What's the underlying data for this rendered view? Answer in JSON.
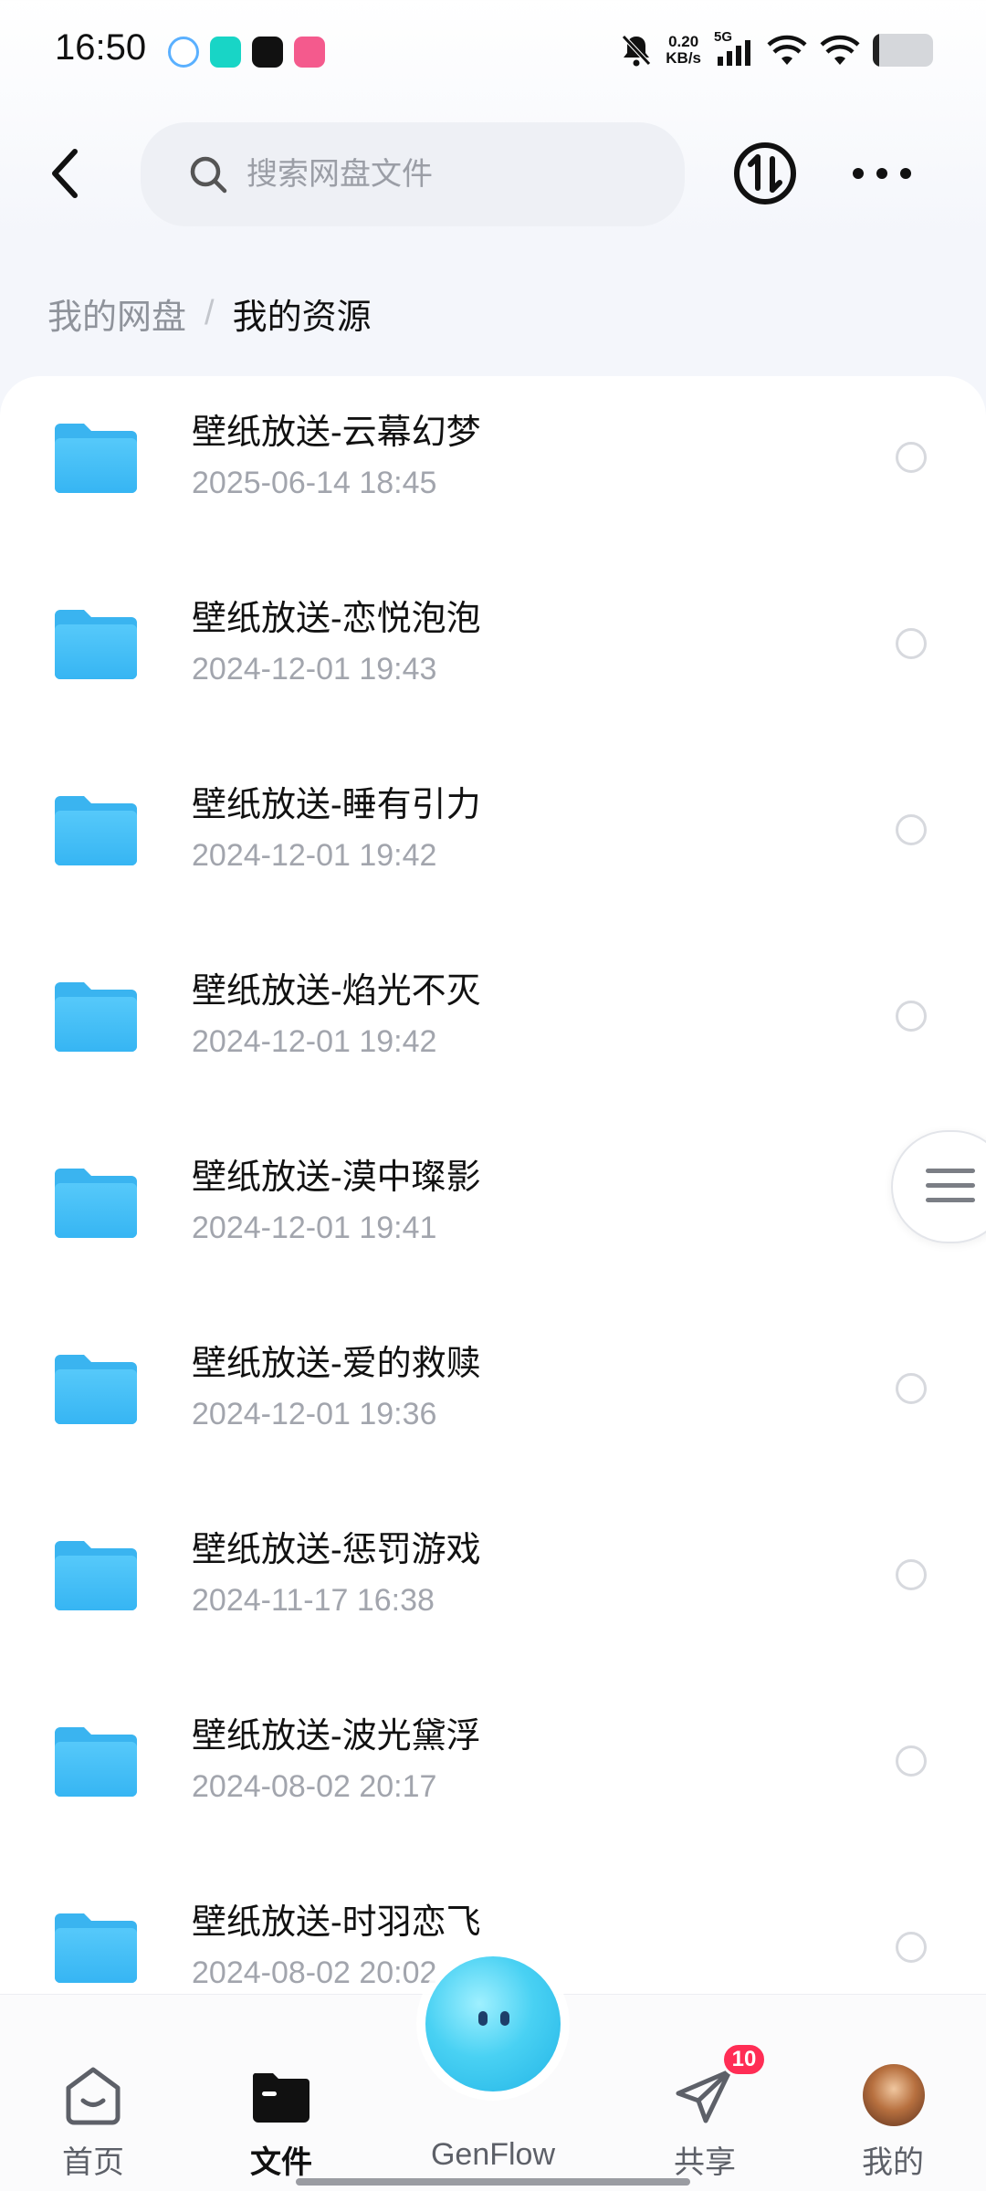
{
  "status_bar": {
    "time": "16:50",
    "net_speed_value": "0.20",
    "net_speed_unit": "KB/s",
    "network": "5G",
    "battery_level": 0.1
  },
  "header": {
    "search_placeholder": "搜索网盘文件"
  },
  "breadcrumb": {
    "root": "我的网盘",
    "separator": "/",
    "current": "我的资源"
  },
  "files": [
    {
      "name": "壁纸放送-云幕幻梦",
      "date": "2025-06-14  18:45"
    },
    {
      "name": "壁纸放送-恋悦泡泡",
      "date": "2024-12-01  19:43"
    },
    {
      "name": "壁纸放送-睡有引力",
      "date": "2024-12-01  19:42"
    },
    {
      "name": "壁纸放送-焰光不灭",
      "date": "2024-12-01  19:42"
    },
    {
      "name": "壁纸放送-漠中璨影",
      "date": "2024-12-01  19:41"
    },
    {
      "name": "壁纸放送-爱的救赎",
      "date": "2024-12-01  19:36"
    },
    {
      "name": "壁纸放送-惩罚游戏",
      "date": "2024-11-17  16:38"
    },
    {
      "name": "壁纸放送-波光黛浮",
      "date": "2024-08-02  20:17"
    },
    {
      "name": "壁纸放送-时羽恋飞",
      "date": "2024-08-02  20:02"
    }
  ],
  "bottom_nav": {
    "home": "首页",
    "files": "文件",
    "genflow": "GenFlow",
    "share": "共享",
    "share_badge": "10",
    "mine": "我的"
  },
  "colors": {
    "folder": "#4fc6f7",
    "badge": "#ff2d55",
    "search_bg": "#eef0f5"
  }
}
